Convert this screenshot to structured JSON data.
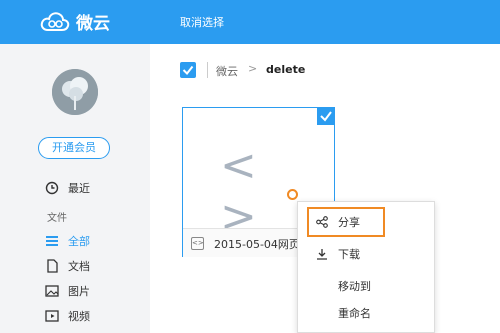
{
  "header": {
    "brand": "微云",
    "cancel_select": "取消选择"
  },
  "sidebar": {
    "vip_label": "开通会员",
    "recent_label": "最近",
    "section_label": "文件",
    "items": [
      {
        "label": "全部",
        "icon": "list-icon"
      },
      {
        "label": "文档",
        "icon": "document-icon"
      },
      {
        "label": "图片",
        "icon": "image-icon"
      },
      {
        "label": "视频",
        "icon": "video-icon"
      }
    ]
  },
  "breadcrumb": {
    "root": "微云",
    "separator": ">",
    "current": "delete"
  },
  "file_card": {
    "glyph": "< >",
    "name": "2015-05-04网页书"
  },
  "context_menu": {
    "items": [
      {
        "label": "分享",
        "icon": "share-icon"
      },
      {
        "label": "下载",
        "icon": "download-icon"
      },
      {
        "label": "移动到"
      },
      {
        "label": "重命名"
      }
    ]
  },
  "colors": {
    "accent": "#2b9cf0",
    "highlight": "#f08a24"
  }
}
